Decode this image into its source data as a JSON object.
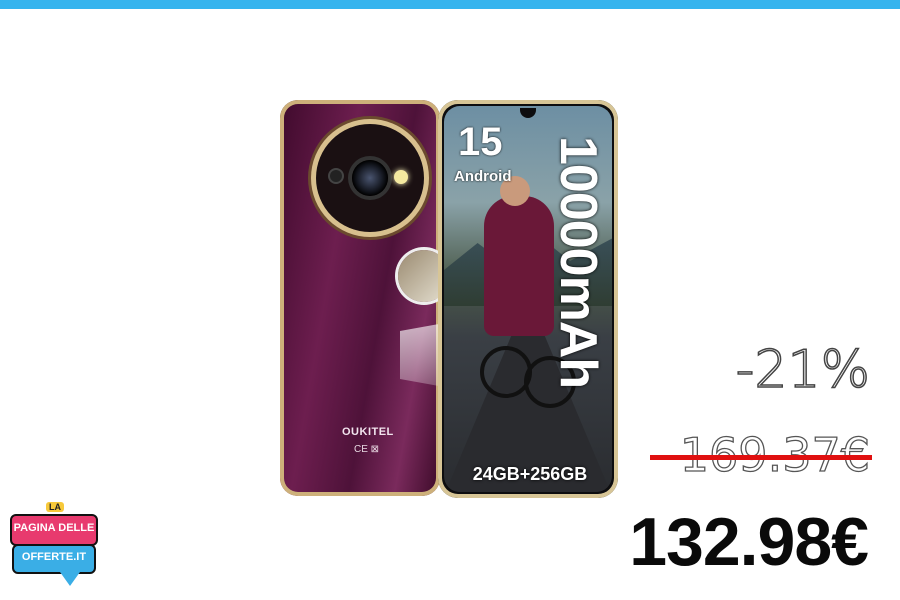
{
  "phone": {
    "brand": "OUKITEL",
    "ce_mark": "CE ⊠",
    "android_number": "15",
    "android_label": "Android",
    "battery": "10000mAh",
    "memory": "24GB+256GB"
  },
  "pricing": {
    "discount": "-21%",
    "old_price": "169.37€",
    "new_price": "132.98€"
  },
  "logo": {
    "la": "LA",
    "line1": "PAGINA DELLE",
    "line2": "OFFERTE.IT"
  },
  "colors": {
    "top_bar": "#35b4ee",
    "strike": "#e01010",
    "phone_body": "#6d1e4f",
    "logo_pink": "#e83a6e",
    "logo_blue": "#3aaee6"
  }
}
